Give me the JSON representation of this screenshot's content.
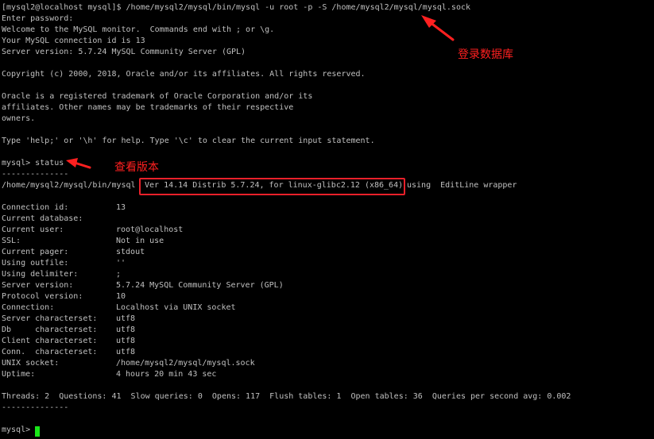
{
  "terminal": {
    "header_lines": [
      "[mysql2@localhost mysql]$ /home/mysql2/mysql/bin/mysql -u root -p -S /home/mysql2/mysql/mysql.sock",
      "Enter password:",
      "Welcome to the MySQL monitor.  Commands end with ; or \\g.",
      "Your MySQL connection id is 13",
      "Server version: 5.7.24 MySQL Community Server (GPL)",
      "",
      "Copyright (c) 2000, 2018, Oracle and/or its affiliates. All rights reserved.",
      "",
      "Oracle is a registered trademark of Oracle Corporation and/or its",
      "affiliates. Other names may be trademarks of their respective",
      "owners.",
      "",
      "Type 'help;' or '\\h' for help. Type '\\c' to clear the current input statement.",
      ""
    ],
    "status_command": "mysql> status",
    "separator": "--------------",
    "version_line": {
      "prefix": "/home/mysql2/mysql/bin/mysql",
      "highlighted": "Ver 14.14 Distrib 5.7.24, for linux-glibc2.12 (x86_64)",
      "suffix": "using  EditLine wrapper"
    },
    "status_rows": [
      {
        "key": "Connection id:",
        "value": "13"
      },
      {
        "key": "Current database:",
        "value": ""
      },
      {
        "key": "Current user:",
        "value": "root@localhost"
      },
      {
        "key": "SSL:",
        "value": "Not in use"
      },
      {
        "key": "Current pager:",
        "value": "stdout"
      },
      {
        "key": "Using outfile:",
        "value": "''"
      },
      {
        "key": "Using delimiter:",
        "value": ";"
      },
      {
        "key": "Server version:",
        "value": "5.7.24 MySQL Community Server (GPL)"
      },
      {
        "key": "Protocol version:",
        "value": "10"
      },
      {
        "key": "Connection:",
        "value": "Localhost via UNIX socket"
      },
      {
        "key": "Server characterset:",
        "value": "utf8"
      },
      {
        "key": "Db     characterset:",
        "value": "utf8"
      },
      {
        "key": "Client characterset:",
        "value": "utf8"
      },
      {
        "key": "Conn.  characterset:",
        "value": "utf8"
      },
      {
        "key": "UNIX socket:",
        "value": "/home/mysql2/mysql/mysql.sock"
      },
      {
        "key": "Uptime:",
        "value": "4 hours 20 min 43 sec"
      }
    ],
    "threads_line": "Threads: 2  Questions: 41  Slow queries: 0  Opens: 117  Flush tables: 1  Open tables: 36  Queries per second avg: 0.002",
    "final_prompt": "mysql>"
  },
  "annotations": {
    "login_label": "登录数据库",
    "version_label": "查看版本"
  },
  "colors": {
    "background": "#000000",
    "text": "#c0c0c0",
    "annotation": "#ff2020",
    "cursor": "#19e619"
  }
}
